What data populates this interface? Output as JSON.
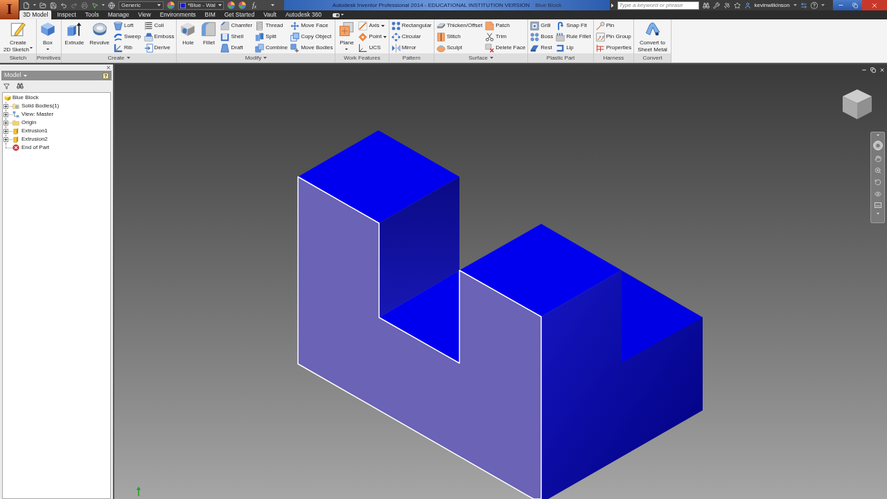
{
  "title_bar": {
    "app_letter": "I",
    "material": "Generic",
    "appearance": "*Blue - Wal",
    "parameters": "f$_{x}$",
    "title": "Autodesk Inventor Professional 2014 - EDUCATIONAL INSTITUTION VERSION",
    "document": "Blue Block",
    "search": {
      "placeholder": "Type a keyword or phrase"
    },
    "user": "kevinwilkinson"
  },
  "tabs": [
    {
      "label": "3D Model",
      "selected": true
    },
    {
      "label": "Inspect",
      "selected": false
    },
    {
      "label": "Tools",
      "selected": false
    },
    {
      "label": "Manage",
      "selected": false
    },
    {
      "label": "View",
      "selected": false
    },
    {
      "label": "Environments",
      "selected": false
    },
    {
      "label": "BIM",
      "selected": false
    },
    {
      "label": "Get Started",
      "selected": false
    },
    {
      "label": "Vault",
      "selected": false
    },
    {
      "label": "Autodesk 360",
      "selected": false
    }
  ],
  "ribbon": {
    "groups": [
      {
        "label": "Sketch",
        "menu": false,
        "tools": [
          {
            "kind": "large",
            "lines": [
              "Create",
              "2D Sketch"
            ],
            "dropdown": true
          }
        ]
      },
      {
        "label": "Primitives",
        "menu": false,
        "tools": [
          {
            "kind": "large",
            "lines": [
              "Box"
            ],
            "dropdown": true
          }
        ]
      },
      {
        "label": "Create",
        "menu": true,
        "tools": [
          {
            "kind": "large",
            "lines": [
              "Extrude"
            ],
            "dropdown": false
          },
          {
            "kind": "large",
            "lines": [
              "Revolve"
            ],
            "dropdown": false
          },
          {
            "kind": "small",
            "label": "Loft",
            "dropdown": false
          },
          {
            "kind": "small",
            "label": "Sweep",
            "dropdown": false
          },
          {
            "kind": "small",
            "label": "Rib",
            "dropdown": false
          },
          {
            "kind": "small",
            "label": "Coil",
            "dropdown": false
          },
          {
            "kind": "small",
            "label": "Emboss",
            "dropdown": false
          },
          {
            "kind": "small",
            "label": "Derive",
            "dropdown": false
          }
        ]
      },
      {
        "label": "Modify",
        "menu": true,
        "tools": [
          {
            "kind": "large",
            "lines": [
              "Hole"
            ],
            "dropdown": false
          },
          {
            "kind": "large",
            "lines": [
              "Fillet"
            ],
            "dropdown": false
          },
          {
            "kind": "small",
            "label": "Chamfer",
            "dropdown": false
          },
          {
            "kind": "small",
            "label": "Shell",
            "dropdown": false
          },
          {
            "kind": "small",
            "label": "Draft",
            "dropdown": false
          },
          {
            "kind": "small",
            "label": "Thread",
            "dropdown": false
          },
          {
            "kind": "small",
            "label": "Split",
            "dropdown": false
          },
          {
            "kind": "small",
            "label": "Combine",
            "dropdown": false
          },
          {
            "kind": "small",
            "label": "Move Face",
            "dropdown": false
          },
          {
            "kind": "small",
            "label": "Copy Object",
            "dropdown": false
          },
          {
            "kind": "small",
            "label": "Move Bodies",
            "dropdown": false
          }
        ]
      },
      {
        "label": "Work Features",
        "menu": false,
        "tools": [
          {
            "kind": "large",
            "lines": [
              "Plane"
            ],
            "dropdown": true
          },
          {
            "kind": "small",
            "label": "Axis",
            "dropdown": true
          },
          {
            "kind": "small",
            "label": "Point",
            "dropdown": true
          },
          {
            "kind": "small",
            "label": "UCS",
            "dropdown": false
          }
        ]
      },
      {
        "label": "Pattern",
        "menu": false,
        "tools": [
          {
            "kind": "small",
            "label": "Rectangular",
            "dropdown": false
          },
          {
            "kind": "small",
            "label": "Circular",
            "dropdown": false
          },
          {
            "kind": "small",
            "label": "Mirror",
            "dropdown": false
          }
        ]
      },
      {
        "label": "Surface",
        "menu": true,
        "tools": [
          {
            "kind": "small",
            "label": "Thicken/Offset",
            "dropdown": false
          },
          {
            "kind": "small",
            "label": "Stitch",
            "dropdown": false
          },
          {
            "kind": "small",
            "label": "Sculpt",
            "dropdown": false
          },
          {
            "kind": "small",
            "label": "Patch",
            "dropdown": false
          },
          {
            "kind": "small",
            "label": "Trim",
            "dropdown": false
          },
          {
            "kind": "small",
            "label": "Delete Face",
            "dropdown": false
          }
        ]
      },
      {
        "label": "Plastic Part",
        "menu": false,
        "tools": [
          {
            "kind": "small",
            "label": "Grill",
            "dropdown": false
          },
          {
            "kind": "small",
            "label": "Boss",
            "dropdown": false
          },
          {
            "kind": "small",
            "label": "Rest",
            "dropdown": false
          },
          {
            "kind": "small",
            "label": "Snap Fit",
            "dropdown": false
          },
          {
            "kind": "small",
            "label": "Rule Fillet",
            "dropdown": false
          },
          {
            "kind": "small",
            "label": "Lip",
            "dropdown": false
          }
        ]
      },
      {
        "label": "Harness",
        "menu": false,
        "tools": [
          {
            "kind": "small",
            "label": "Pin",
            "dropdown": false
          },
          {
            "kind": "small",
            "label": "Pin Group",
            "dropdown": false
          },
          {
            "kind": "small",
            "label": "Properties",
            "dropdown": false
          }
        ]
      },
      {
        "label": "Convert",
        "menu": false,
        "tools": [
          {
            "kind": "large",
            "lines": [
              "Convert to",
              "Sheet Metal"
            ],
            "dropdown": false
          }
        ]
      }
    ]
  },
  "browser": {
    "title": "Model",
    "tree": [
      {
        "label": "Blue Block",
        "kind": "part",
        "children": [
          {
            "label": "Solid Bodies(1)",
            "kind": "bodies",
            "expanded": false
          },
          {
            "label": "View: Master",
            "kind": "view",
            "expanded": false
          },
          {
            "label": "Origin",
            "kind": "origin",
            "expanded": false
          },
          {
            "label": "Extrusion1",
            "kind": "feature",
            "expanded": false
          },
          {
            "label": "Extrusion2",
            "kind": "feature",
            "expanded": false
          },
          {
            "label": "End of Part",
            "kind": "end"
          }
        ]
      }
    ]
  }
}
